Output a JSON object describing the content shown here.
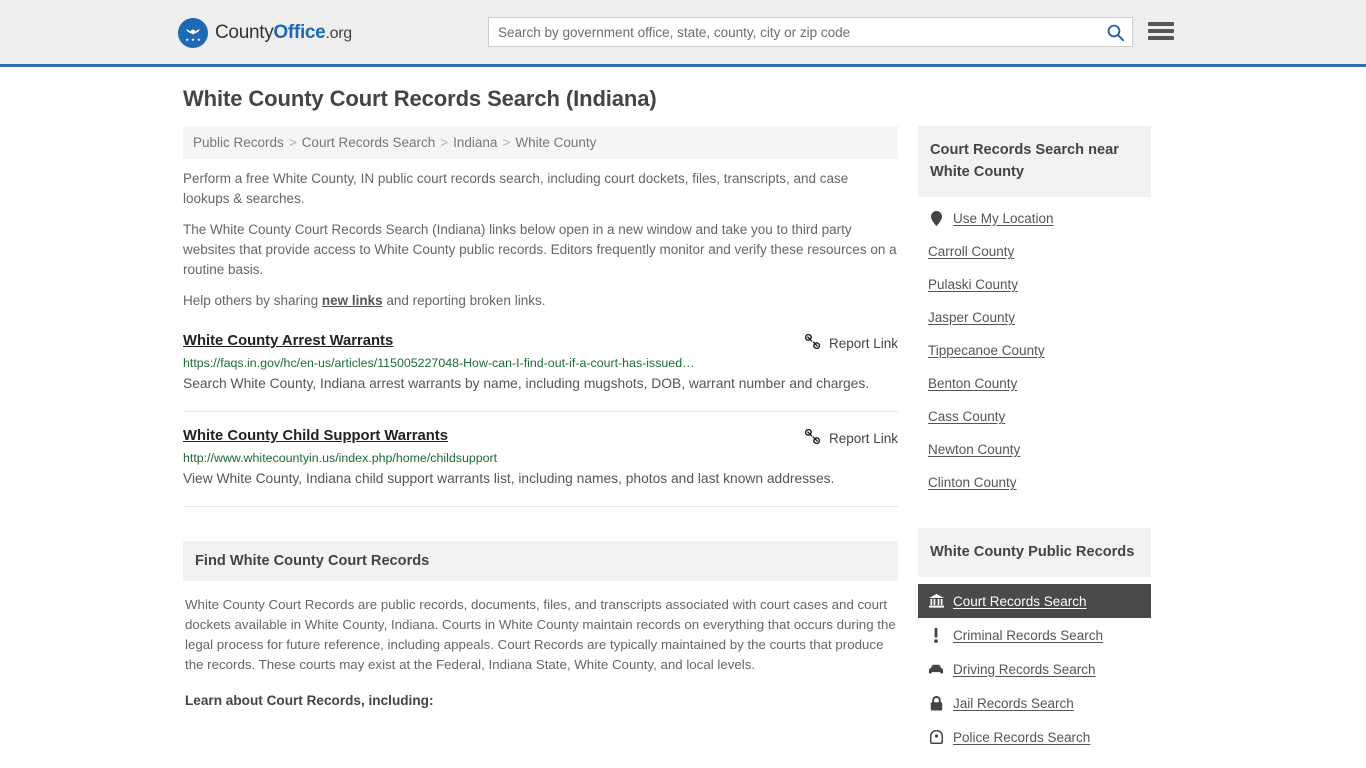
{
  "header": {
    "logo": {
      "text_county": "County",
      "text_office": "Office",
      "text_org": ".org",
      "icon": "eagle-seal-icon"
    },
    "search": {
      "placeholder": "Search by government office, state, county, city or zip code",
      "value": "",
      "search_icon": "search-icon"
    },
    "menu_icon": "hamburger-menu-icon",
    "accent_color": "#2f6fad",
    "background_color": "#eeeeee"
  },
  "page": {
    "title": "White County Court Records Search (Indiana)"
  },
  "breadcrumb": {
    "separator": ">",
    "items": [
      {
        "label": "Public Records"
      },
      {
        "label": "Court Records Search"
      },
      {
        "label": "Indiana"
      },
      {
        "label": "White County"
      }
    ]
  },
  "intro": {
    "p1": "Perform a free White County, IN public court records search, including court dockets, files, transcripts, and case lookups & searches.",
    "p2": "The White County Court Records Search (Indiana) links below open in a new window and take you to third party websites that provide access to White County public records. Editors frequently monitor and verify these resources on a routine basis.",
    "p3_before": "Help others by sharing ",
    "p3_link": "new links",
    "p3_after": " and reporting broken links."
  },
  "results": [
    {
      "title": "White County Arrest Warrants",
      "url": "https://faqs.in.gov/hc/en-us/articles/115005227048-How-can-I-find-out-if-a-court-has-issued…",
      "description": "Search White County, Indiana arrest warrants by name, including mugshots, DOB, warrant number and charges.",
      "report_label": "Report Link",
      "report_icon": "broken-link-icon"
    },
    {
      "title": "White County Child Support Warrants",
      "url": "http://www.whitecountyin.us/index.php/home/childsupport",
      "description": "View White County, Indiana child support warrants list, including names, photos and last known addresses.",
      "report_label": "Report Link",
      "report_icon": "broken-link-icon"
    }
  ],
  "find_section": {
    "heading": "Find White County Court Records",
    "paragraph": "White County Court Records are public records, documents, files, and transcripts associated with court cases and court dockets available in White County, Indiana. Courts in White County maintain records on everything that occurs during the legal process for future reference, including appeals. Court Records are typically maintained by the courts that produce the records. These courts may exist at the Federal, Indiana State, White County, and local levels.",
    "learn_heading": "Learn about Court Records, including:"
  },
  "sidebar": {
    "near_block": {
      "heading": "Court Records Search near White County",
      "items": [
        {
          "label": "Use My Location",
          "icon": "map-pin-icon",
          "has_icon": true
        },
        {
          "label": "Carroll County",
          "icon": "",
          "has_icon": false
        },
        {
          "label": "Pulaski County",
          "icon": "",
          "has_icon": false
        },
        {
          "label": "Jasper County",
          "icon": "",
          "has_icon": false
        },
        {
          "label": "Tippecanoe County",
          "icon": "",
          "has_icon": false
        },
        {
          "label": "Benton County",
          "icon": "",
          "has_icon": false
        },
        {
          "label": "Cass County",
          "icon": "",
          "has_icon": false
        },
        {
          "label": "Newton County",
          "icon": "",
          "has_icon": false
        },
        {
          "label": "Clinton County",
          "icon": "",
          "has_icon": false
        }
      ]
    },
    "public_records_block": {
      "heading": "White County Public Records",
      "active_index": 0,
      "active_background": "#4a4a4a",
      "items": [
        {
          "label": "Court Records Search",
          "icon": "courthouse-icon",
          "active": true
        },
        {
          "label": "Criminal Records Search",
          "icon": "exclamation-icon",
          "active": false
        },
        {
          "label": "Driving Records Search",
          "icon": "car-icon",
          "active": false
        },
        {
          "label": "Jail Records Search",
          "icon": "lock-icon",
          "active": false
        },
        {
          "label": "Police Records Search",
          "icon": "police-badge-icon",
          "active": false
        }
      ]
    }
  }
}
